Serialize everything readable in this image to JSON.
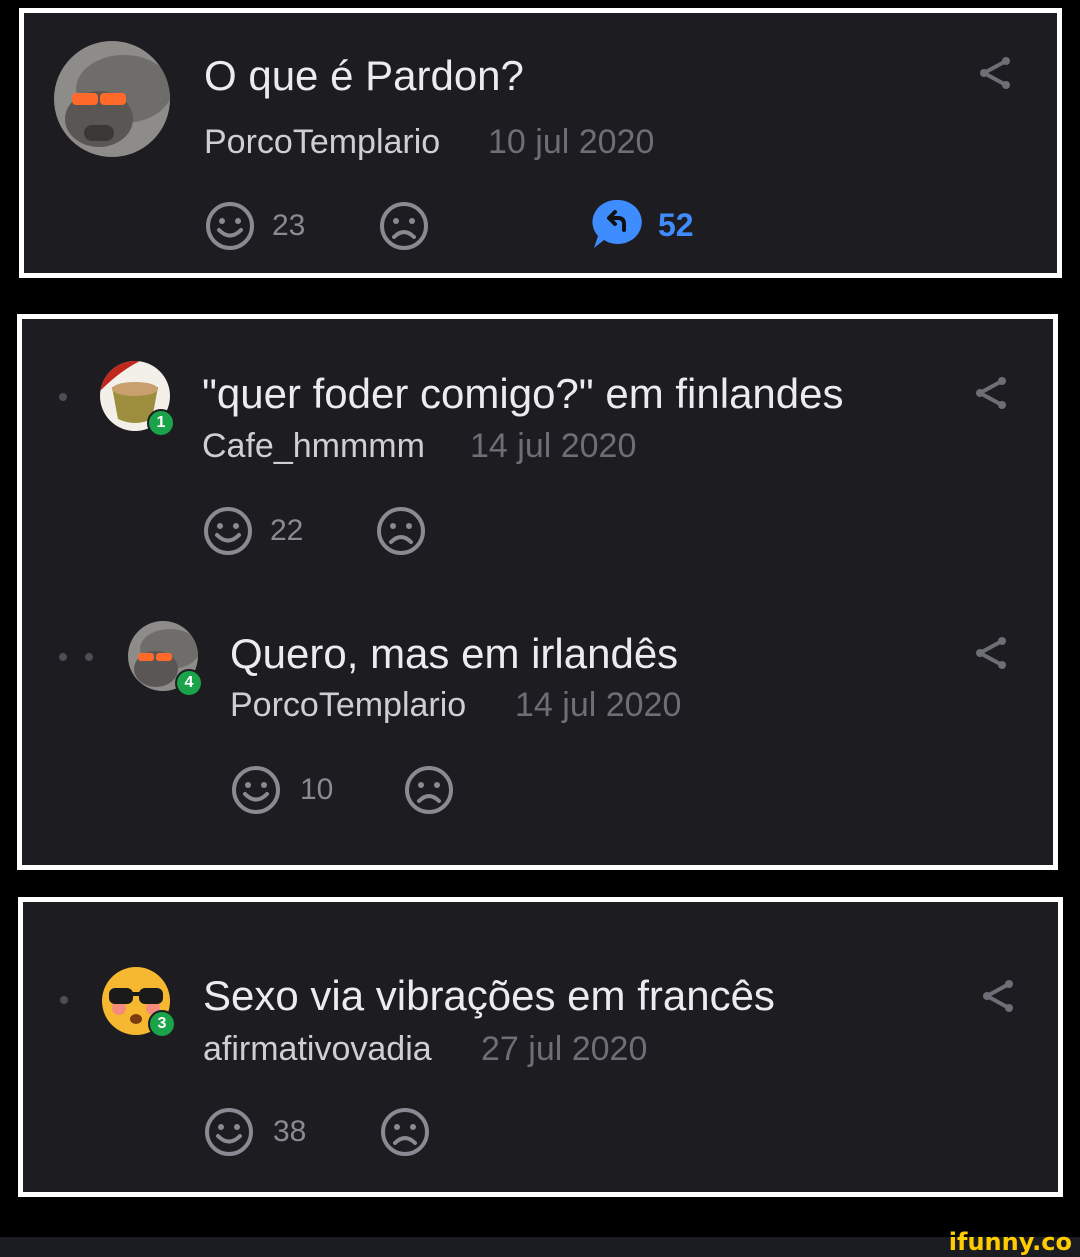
{
  "posts": [
    {
      "title": "O que é Pardon?",
      "author": "PorcoTemplario",
      "date": "10 jul 2020",
      "likes": "23",
      "replies": "52"
    },
    {
      "title": "\"quer foder comigo?\" em finlandes",
      "author": "Cafe_hmmmm",
      "date": "14 jul 2020",
      "likes": "22",
      "badge": "1"
    },
    {
      "title": "Quero, mas em irlandês",
      "author": "PorcoTemplario",
      "date": "14 jul 2020",
      "likes": "10",
      "badge": "4"
    },
    {
      "title": "Sexo via vibrações em francês",
      "author": "afirmativovadia",
      "date": "27 jul 2020",
      "likes": "38",
      "badge": "3"
    }
  ],
  "watermark": "ifunny.co",
  "colors": {
    "panel_bg": "#1c1c21",
    "panel_border": "#ffffff",
    "reply_accent": "#3f8cff",
    "badge_green": "#1aa34a",
    "watermark": "#ffcc00"
  }
}
